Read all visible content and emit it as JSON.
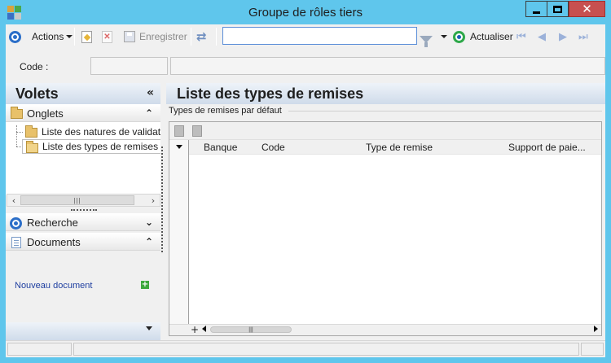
{
  "window": {
    "title": "Groupe de rôles tiers"
  },
  "toolbar": {
    "actions_label": "Actions",
    "save_label": "Enregistrer",
    "search_value": "",
    "refresh_label": "Actualiser"
  },
  "header": {
    "code_label": "Code :"
  },
  "left_panel": {
    "title": "Volets",
    "sections": {
      "onglets": "Onglets",
      "recherche": "Recherche",
      "documents": "Documents"
    },
    "tree_items": [
      {
        "label": "Liste des natures de validation"
      },
      {
        "label": "Liste des types de remises"
      }
    ],
    "new_document": "Nouveau document"
  },
  "main": {
    "title": "Liste des types de remises",
    "group_label": "Types de remises par défaut",
    "columns": [
      "Banque",
      "Code",
      "Type de remise",
      "Support de paie..."
    ]
  },
  "colors": {
    "titlebar": "#5fc6ec",
    "close": "#c75050",
    "panel_header": "#cfdbea",
    "link": "#1f3fa0"
  }
}
